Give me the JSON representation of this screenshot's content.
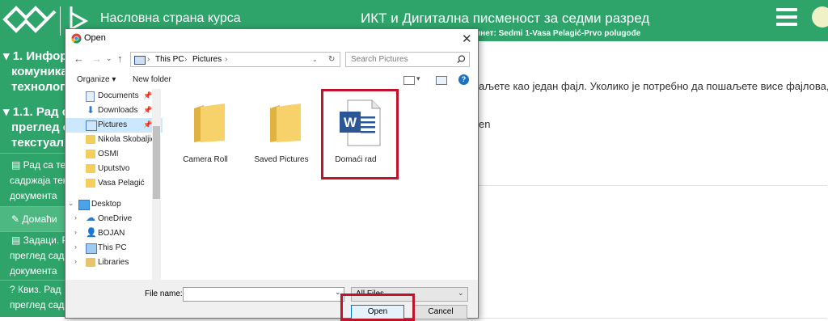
{
  "header": {
    "course_link": "Насловна страна курса",
    "title": "ИКТ и Дигитална писменост за седми разред",
    "subline": "инет: Sedmi 1-Vasa Pelagić-Prvo polugođe",
    "menu_icon": "hamburger-icon",
    "avatar_icon": "smiley-icon"
  },
  "sidebar": {
    "items": [
      {
        "label": "1. Инфор",
        "icon": "chevron-down-icon"
      },
      {
        "label": "комуника"
      },
      {
        "label": "технолог"
      },
      {
        "label": "1.1. Рад са",
        "icon": "chevron-down-icon"
      },
      {
        "label": "преглед с"
      },
      {
        "label": "текстуал"
      },
      {
        "label": "Рад са те",
        "icon": "file-icon"
      },
      {
        "label": "садржаја текс"
      },
      {
        "label": "документа"
      },
      {
        "label": "Домаћи",
        "icon": "pencil-icon"
      },
      {
        "label": "Задаци. Р",
        "icon": "file-icon"
      },
      {
        "label": "преглед садр"
      },
      {
        "label": "документа"
      },
      {
        "label": "Квиз. Рад",
        "icon": "question-icon"
      },
      {
        "label": "преглед садр"
      }
    ]
  },
  "main": {
    "line1": "аљете као један фајл. Уколико је потребно да пошаљете висе фајлова,",
    "line2": "en"
  },
  "dialog": {
    "title": "Open",
    "close": "✕",
    "nav": {
      "back": "←",
      "forward": "→",
      "dropdown": "⌄",
      "up": "↑"
    },
    "address": [
      "This PC",
      "Pictures"
    ],
    "address_sep": "›",
    "refresh": "↻",
    "search_placeholder": "Search Pictures",
    "toolbar": {
      "organize": "Organize ▾",
      "new_folder": "New folder"
    },
    "nav_items": [
      {
        "label": "Documents",
        "icon": "documents-icon",
        "pinned": true
      },
      {
        "label": "Downloads",
        "icon": "downloads-icon",
        "pinned": true
      },
      {
        "label": "Pictures",
        "icon": "pictures-icon",
        "pinned": true,
        "selected": true
      },
      {
        "label": "Nikola Skobaljić",
        "icon": "folder-icon"
      },
      {
        "label": "OSMI",
        "icon": "folder-icon"
      },
      {
        "label": "Uputstvo",
        "icon": "folder-icon"
      },
      {
        "label": "Vasa Pelagić",
        "icon": "folder-icon"
      },
      {
        "label": "Desktop",
        "icon": "desktop-icon",
        "expanded": true
      },
      {
        "label": "OneDrive",
        "icon": "cloud-icon"
      },
      {
        "label": "BOJAN",
        "icon": "user-icon"
      },
      {
        "label": "This PC",
        "icon": "pc-icon"
      },
      {
        "label": "Libraries",
        "icon": "libraries-icon"
      }
    ],
    "pin_glyph": "📌",
    "expand_glyph": "›",
    "collapse_glyph": "⌄",
    "files": [
      {
        "label": "Camera Roll",
        "icon": "folder-icon"
      },
      {
        "label": "Saved Pictures",
        "icon": "folder-icon"
      },
      {
        "label": "Domaći rad",
        "icon": "word-document-icon"
      }
    ],
    "file_name_label": "File name:",
    "file_name_value": "",
    "filter": "All Files",
    "open": "Open",
    "cancel": "Cancel"
  },
  "colors": {
    "header_green": "#2ea36a",
    "highlight_red": "#c0142b",
    "accent_blue": "#0078d7",
    "word_blue": "#2b5797"
  }
}
